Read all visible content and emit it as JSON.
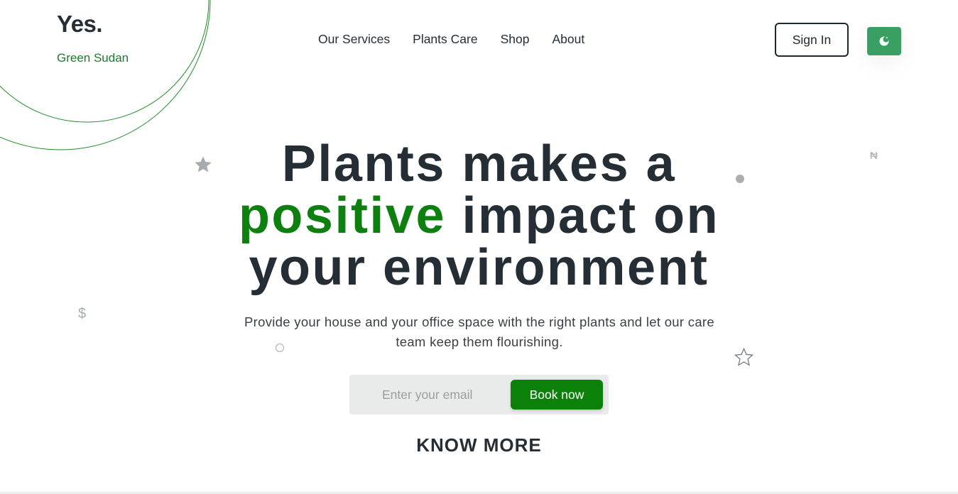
{
  "brand": {
    "title": "Yes.",
    "subtitle": "Green Sudan"
  },
  "nav": {
    "items": [
      {
        "label": "Our Services"
      },
      {
        "label": "Plants Care"
      },
      {
        "label": "Shop"
      },
      {
        "label": "About"
      }
    ]
  },
  "header": {
    "signin_label": "Sign In",
    "theme_toggle_icon": "moon-icon"
  },
  "hero": {
    "title_line1": "Plants makes a",
    "title_highlight": "positive",
    "title_line2_rest": " impact on",
    "title_line3": "your environment",
    "subtitle": "Provide your house and your office space with the right plants and let our care team keep them flourishing."
  },
  "signup": {
    "email_placeholder": "Enter your email",
    "email_value": "",
    "book_label": "Book now"
  },
  "cta": {
    "know_more_label": "KNOW MORE"
  },
  "decorations": {
    "dollar_symbol": "$",
    "naira_symbol": "₦"
  },
  "colors": {
    "accent_green": "#0d8010",
    "theme_button_green": "#3a9f63",
    "circle_stroke": "#1e8a2a",
    "text_dark": "#252d35"
  }
}
